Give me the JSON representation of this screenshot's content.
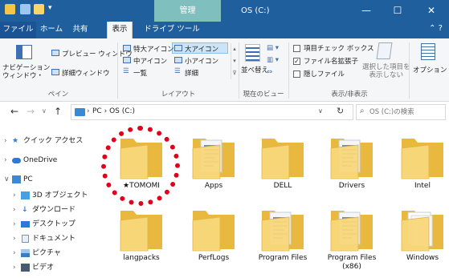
{
  "titlebar": {
    "manage_tab": "管理",
    "window_title": "OS (C:)",
    "minimize": "—",
    "maximize": "☐",
    "close": "✕"
  },
  "ribbon_tabs": [
    "ファイル",
    "ホーム",
    "共有",
    "表示",
    "ドライブ ツール"
  ],
  "ribbon": {
    "pane": {
      "nav_pane": "ナビゲーション\nウィンドウ・",
      "preview": "プレビュー ウィンドウ",
      "details": "詳細ウィンドウ",
      "group": "ペイン"
    },
    "layout": {
      "items": [
        "特大アイコン",
        "大アイコン",
        "中アイコン",
        "小アイコン",
        "一覧",
        "詳細"
      ],
      "group": "レイアウト"
    },
    "current_view": {
      "sort": "並べ替え",
      "group": "現在のビュー"
    },
    "show_hide": {
      "item_checkbox": "項目チェック ボックス",
      "file_ext": "ファイル名拡張子",
      "hidden": "隠しファイル",
      "hide_selected": "選択した項目を\n表示しない",
      "options": "オプション",
      "group": "表示/非表示",
      "checked": [
        false,
        true,
        false
      ]
    }
  },
  "address": {
    "path": [
      "PC",
      "OS (C:)"
    ],
    "search_placeholder": "OS (C:)の検索"
  },
  "navpane": [
    {
      "label": "クイック アクセス",
      "icon": "star-icon",
      "expanded": false
    },
    {
      "label": "OneDrive",
      "icon": "cloud-icon",
      "expanded": false
    },
    {
      "label": "PC",
      "icon": "pc-icon",
      "expanded": true
    },
    {
      "label": "3D オブジェクト",
      "icon": "cube-icon",
      "expanded": false
    },
    {
      "label": "ダウンロード",
      "icon": "download-icon",
      "expanded": false
    },
    {
      "label": "デスクトップ",
      "icon": "desktop-icon",
      "expanded": false
    },
    {
      "label": "ドキュメント",
      "icon": "document-icon",
      "expanded": false
    },
    {
      "label": "ピクチャ",
      "icon": "picture-icon",
      "expanded": false
    },
    {
      "label": "ビデオ",
      "icon": "video-icon",
      "expanded": false
    }
  ],
  "folders": [
    {
      "name": "★TOMOMI",
      "type": "empty"
    },
    {
      "name": "Apps",
      "type": "docs"
    },
    {
      "name": "DELL",
      "type": "empty"
    },
    {
      "name": "Drivers",
      "type": "docs"
    },
    {
      "name": "Intel",
      "type": "empty"
    },
    {
      "name": "langpacks",
      "type": "empty"
    },
    {
      "name": "PerfLogs",
      "type": "empty"
    },
    {
      "name": "Program Files",
      "type": "docs"
    },
    {
      "name": "Program Files\n(x86)",
      "type": "docs"
    },
    {
      "name": "Windows",
      "type": "white"
    }
  ],
  "colors": {
    "titlebar": "#1f5f9e",
    "manage_tab": "#7fbfbd",
    "folder_back": "#e8b93e",
    "folder_front": "#f8d77a",
    "annotation_circle": "#e3001b"
  }
}
